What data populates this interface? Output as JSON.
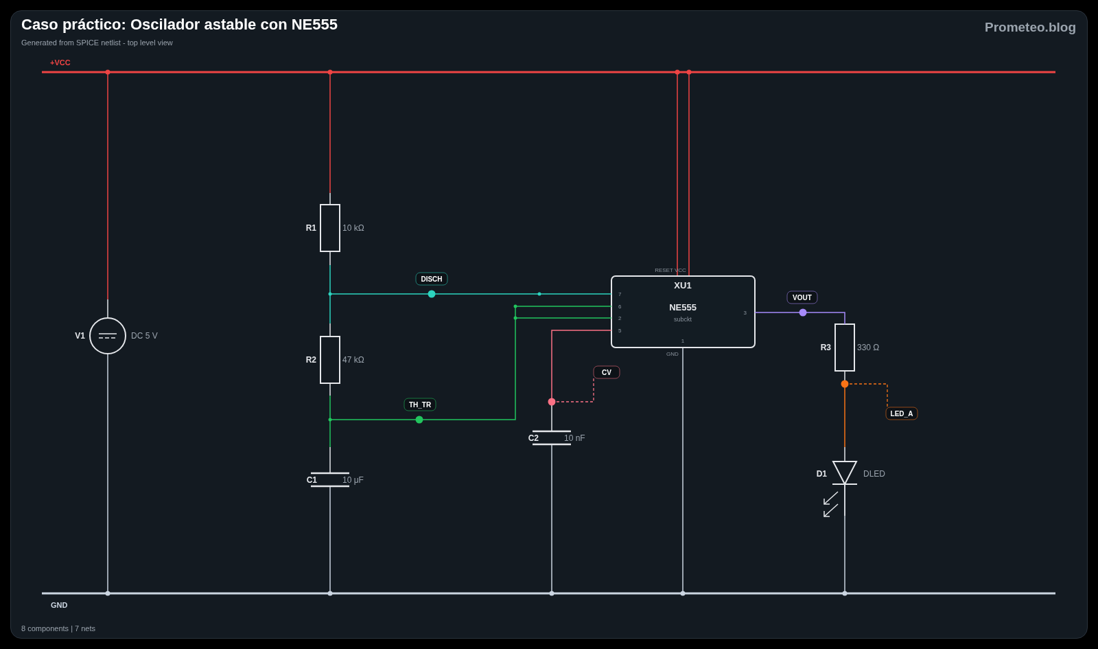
{
  "header": {
    "title": "Caso práctico: Oscilador astable con NE555",
    "subtitle": "Generated from SPICE netlist - top level view",
    "brand": "Prometeo.blog"
  },
  "rails": [
    {
      "kind": "power",
      "label": "+VCC"
    },
    {
      "kind": "ground",
      "label": "GND"
    }
  ],
  "components": [
    {
      "kind": "source",
      "ref": "V1",
      "value": "DC 5 V"
    },
    {
      "kind": "resistor",
      "ref": "R1",
      "value": "10 kΩ"
    },
    {
      "kind": "resistor",
      "ref": "R2",
      "value": "47 kΩ"
    },
    {
      "kind": "capacitor",
      "ref": "C1",
      "value": "10 μF"
    },
    {
      "kind": "capacitor",
      "ref": "C2",
      "value": "10 nF"
    },
    {
      "kind": "ic",
      "ref": "XU1",
      "value": "NE555",
      "model": "subckt",
      "top_label": "RESET VCC",
      "bottom_label": "GND",
      "left_pins": [
        "7",
        "6",
        "2",
        "5"
      ],
      "right_pins": [
        "3"
      ],
      "bottom_pins": [
        "1"
      ]
    },
    {
      "kind": "resistor",
      "ref": "R3",
      "value": "330 Ω"
    },
    {
      "kind": "led",
      "ref": "D1",
      "value": "DLED"
    }
  ],
  "nets": [
    {
      "label": "DISCH",
      "color": "#2dd4bf"
    },
    {
      "label": "TH_TR",
      "color": "#22c55e"
    },
    {
      "label": "CV",
      "color": "#fb7185"
    },
    {
      "label": "VOUT",
      "color": "#a78bfa"
    },
    {
      "label": "LED_A",
      "color": "#f97316"
    }
  ],
  "footer": "8 components | 7 nets"
}
